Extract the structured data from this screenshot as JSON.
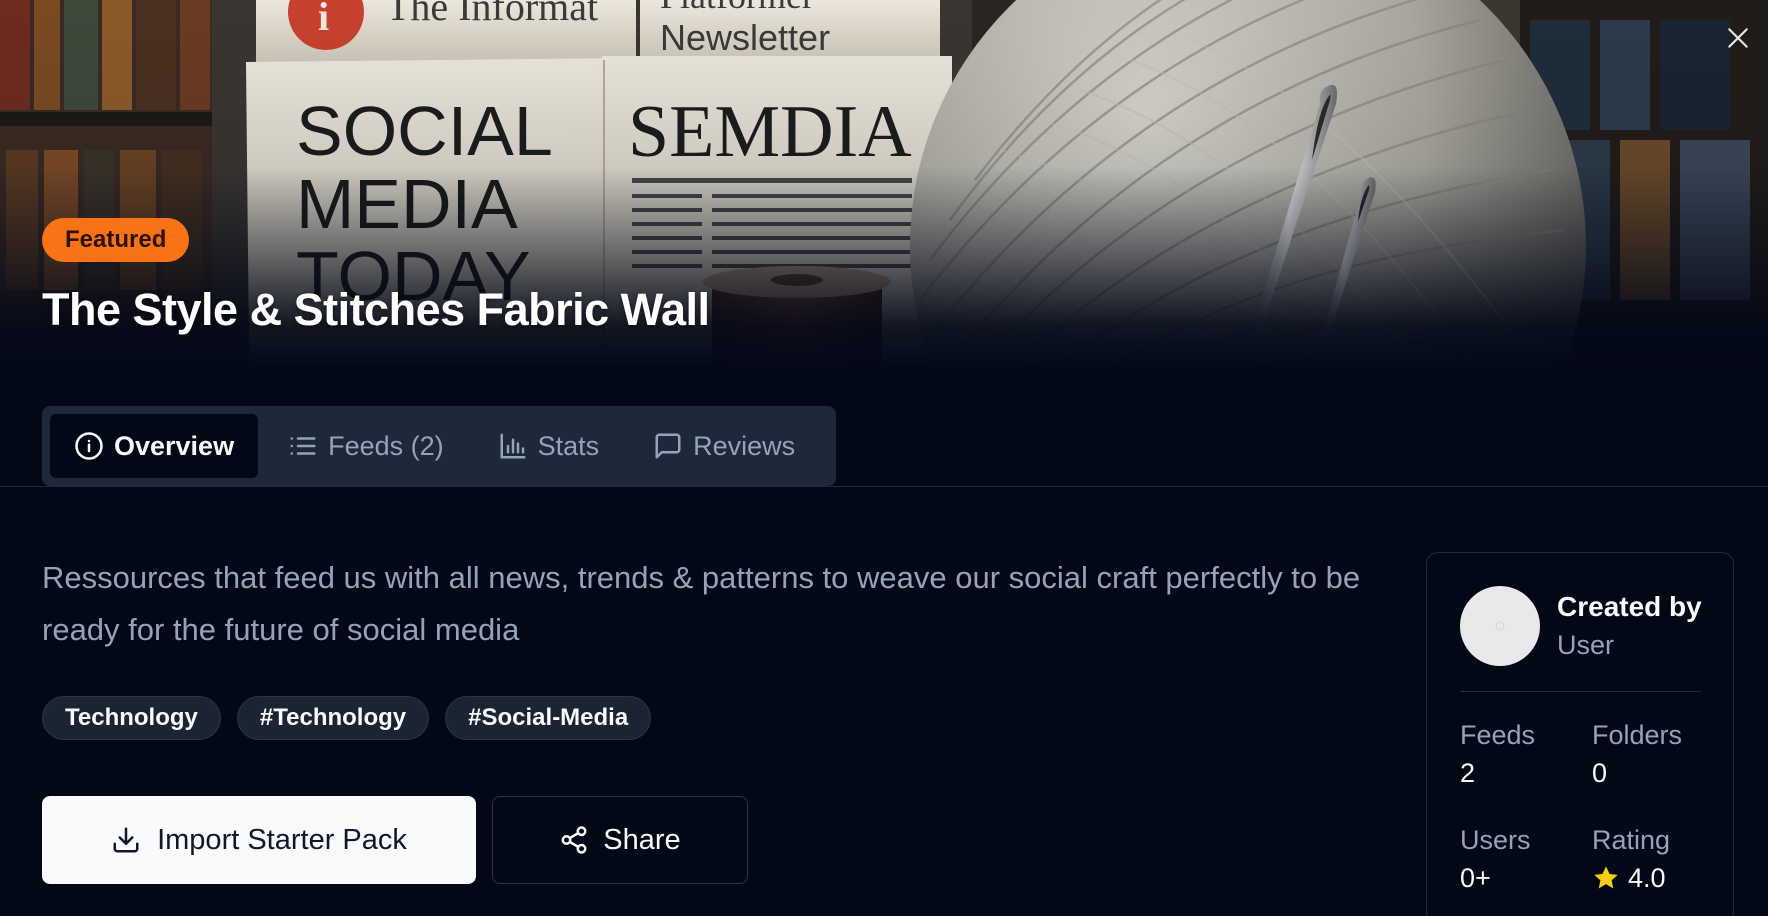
{
  "hero": {
    "image_label": "The Informat Platformer Newsletter SOCIAL MEDIA TODAY SEMDIA",
    "badge": "Featured",
    "title": "The Style & Stitches Fabric Wall",
    "close_icon": "close-icon"
  },
  "tabs": [
    {
      "label": "Overview",
      "icon": "info-icon",
      "active": true
    },
    {
      "label": "Feeds (2)",
      "icon": "list-icon",
      "active": false
    },
    {
      "label": "Stats",
      "icon": "bar-chart-icon",
      "active": false
    },
    {
      "label": "Reviews",
      "icon": "message-square-icon",
      "active": false
    }
  ],
  "main": {
    "description": "Ressources that feed us with all news, trends & patterns to weave our social craft perfectly to be ready for the future of social media",
    "tags": [
      "Technology",
      "#Technology",
      "#Social-Media"
    ],
    "import_label": "Import Starter Pack",
    "import_icon": "download-icon",
    "share_label": "Share",
    "share_icon": "share-icon"
  },
  "sidebar": {
    "created_by_label": "Created by",
    "creator_name": "User",
    "stats": {
      "feeds_label": "Feeds",
      "feeds_value": "2",
      "folders_label": "Folders",
      "folders_value": "0",
      "users_label": "Users",
      "users_value": "0+",
      "rating_label": "Rating",
      "rating_value": "4.0",
      "rating_icon": "star-icon"
    }
  },
  "colors": {
    "background": "#030817",
    "accent_featured": "#f97316",
    "tab_bar": "#1d283a",
    "muted_text": "#94a3b8",
    "star": "#facc15"
  }
}
